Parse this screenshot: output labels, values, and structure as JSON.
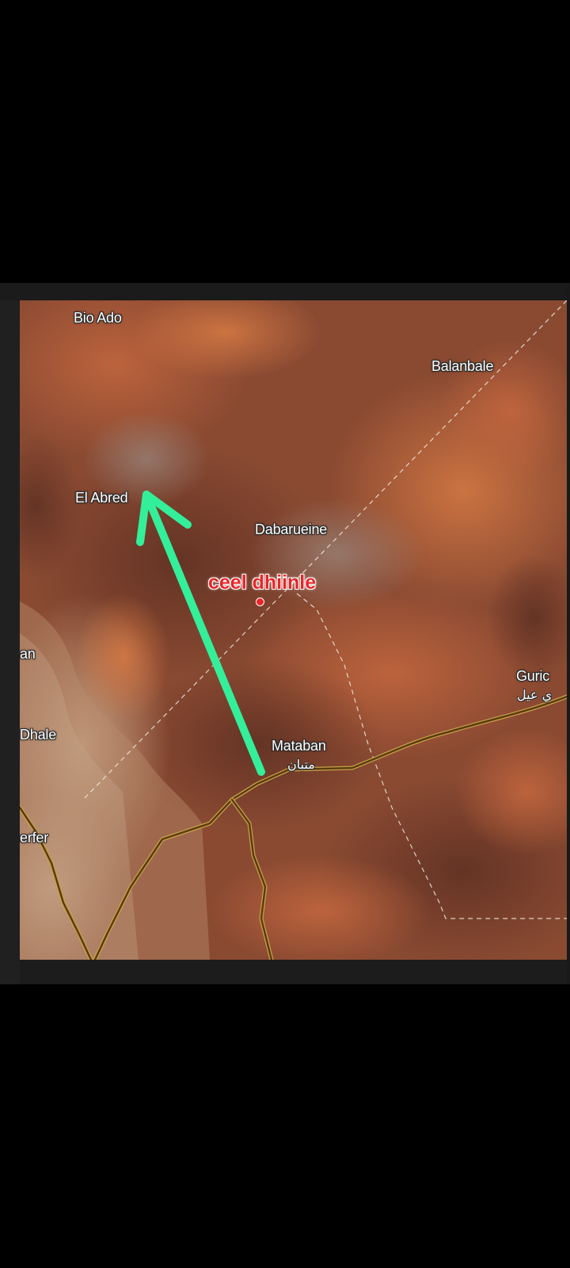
{
  "map": {
    "places": [
      {
        "id": "bio-ado",
        "name": "Bio Ado"
      },
      {
        "id": "balanbale",
        "name": "Balanbale"
      },
      {
        "id": "el-abred",
        "name": "El Abred"
      },
      {
        "id": "dabarueine",
        "name": "Dabarueine"
      },
      {
        "id": "mataban",
        "name": "Mataban",
        "local_name": "متبان"
      },
      {
        "id": "guric",
        "name": "Guric",
        "local_name": "ي عيل"
      },
      {
        "id": "an",
        "name": "an"
      },
      {
        "id": "dhale",
        "name": "Dhale"
      },
      {
        "id": "ferfer",
        "name": "erfer"
      }
    ],
    "marker": {
      "label": "ceel dhiinle",
      "color": "#e8262a"
    },
    "arrow": {
      "color": "#34ef9a",
      "from": "Mataban",
      "to": "El Abred"
    },
    "colors": {
      "terrain": "#8a4a32",
      "road": "#5a3a0e",
      "road_casing": "#c9a24a",
      "border": "#f2ece4"
    }
  }
}
